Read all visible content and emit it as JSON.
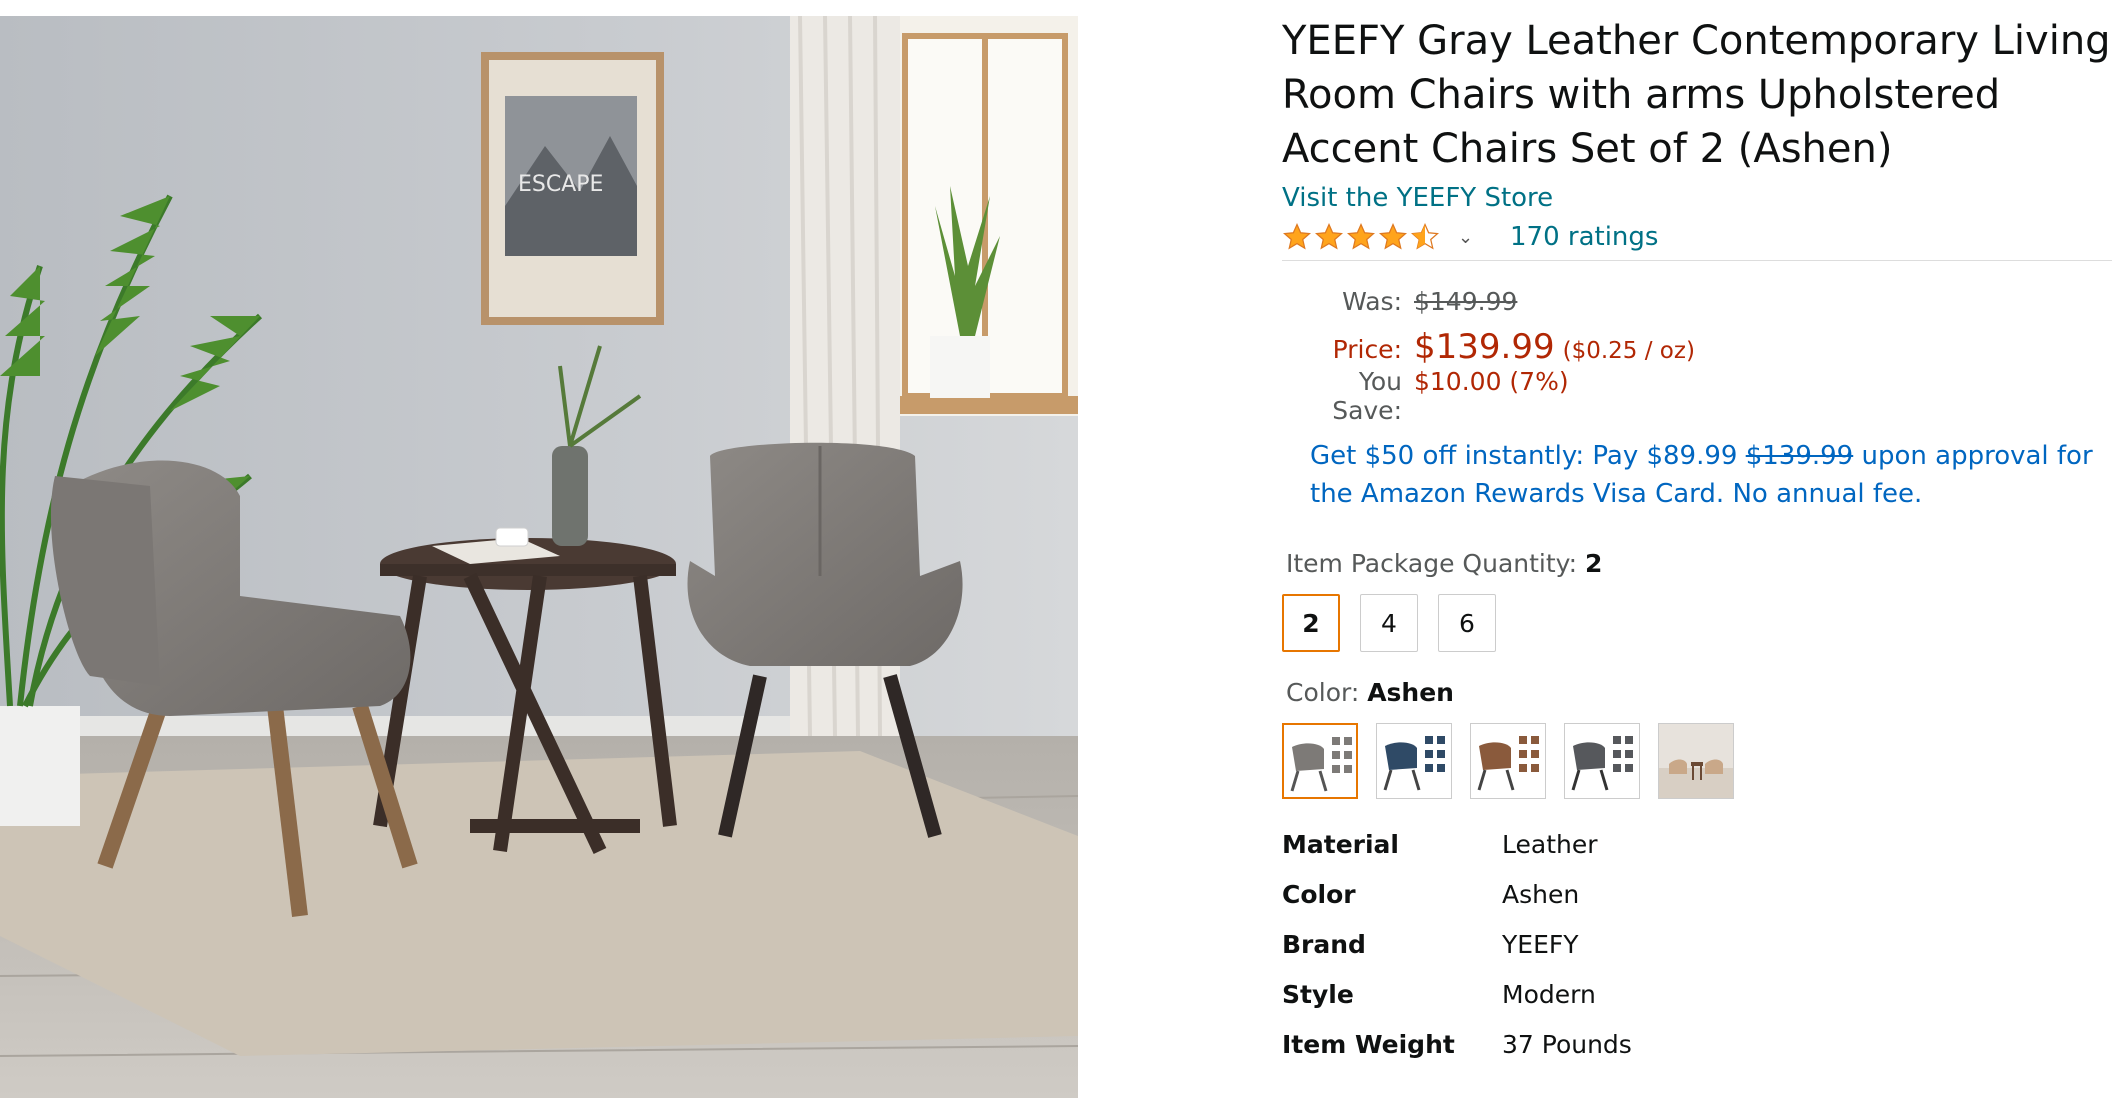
{
  "product": {
    "title": "YEEFY Gray Leather Contemporary Living Room Chairs with arms Upholstered Accent Chairs Set of 2 (Ashen)",
    "store_link": "Visit the YEEFY Store",
    "rating_value": 4.5,
    "ratings_count": "170 ratings",
    "hero_poster_text": "ESCAPE"
  },
  "pricing": {
    "was_label": "Was:",
    "was_value": "$149.99",
    "price_label": "Price:",
    "price_value": "$139.99",
    "unit_price": "($0.25 / oz)",
    "save_label": "You Save:",
    "save_value": "$10.00 (7%)"
  },
  "promo": {
    "part1": "Get $50 off instantly: Pay $89.99 ",
    "strike": "$139.99",
    "part2": " upon approval for the Amazon Rewards Visa Card. No annual fee."
  },
  "quantity": {
    "label": "Item Package Quantity: ",
    "selected": "2",
    "options": [
      "2",
      "4",
      "6"
    ]
  },
  "color": {
    "label": "Color: ",
    "selected": "Ashen",
    "swatch_colors": [
      "#7d7a77",
      "#2f4a66",
      "#8a5a3c",
      "#56585c",
      "#c9a889"
    ]
  },
  "specs": [
    {
      "key": "Material",
      "value": "Leather"
    },
    {
      "key": "Color",
      "value": "Ashen"
    },
    {
      "key": "Brand",
      "value": "YEEFY"
    },
    {
      "key": "Style",
      "value": "Modern"
    },
    {
      "key": "Item Weight",
      "value": "37 Pounds"
    }
  ],
  "colors": {
    "link": "#007185",
    "price_red": "#b12704",
    "promo_blue": "#0066c0",
    "selected_orange": "#e77600",
    "star_orange": "#ffa41c"
  }
}
